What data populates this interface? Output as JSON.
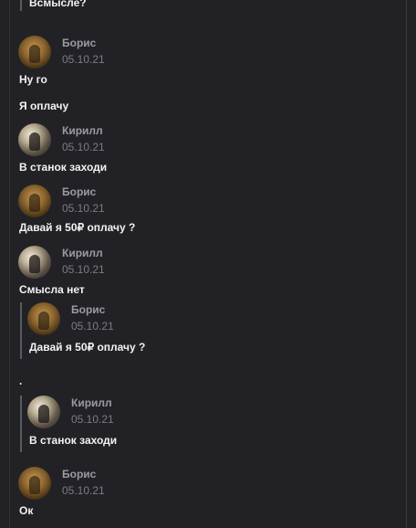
{
  "messages": [
    {
      "text": "Всмысле?"
    },
    {
      "author": "Борис",
      "date": "05.10.21",
      "text": "Ну го"
    },
    {
      "text": "Я оплачу"
    },
    {
      "author": "Кирилл",
      "date": "05.10.21",
      "text": "В станок заходи"
    },
    {
      "author": "Борис",
      "date": "05.10.21",
      "text": "Давай я 50₽ оплачу ?"
    },
    {
      "author": "Кирилл",
      "date": "05.10.21",
      "text": "Смысла нет"
    },
    {
      "quote": {
        "author": "Борис",
        "date": "05.10.21",
        "text": "Давай я 50₽ оплачу ?"
      },
      "text": "."
    },
    {
      "quote": {
        "author": "Кирилл",
        "date": "05.10.21",
        "text": "В станок заходи"
      }
    },
    {
      "author": "Борис",
      "date": "05.10.21",
      "text": "Ок"
    }
  ]
}
